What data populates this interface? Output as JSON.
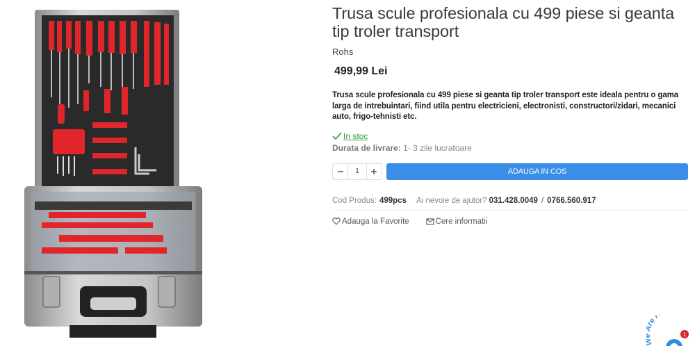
{
  "product": {
    "title": "Trusa scule profesionala cu 499 piese si geanta tip troler transport",
    "brand": "Rohs",
    "price": "499,99 Lei",
    "description": "Trusa scule profesionala cu 499 piese si geanta tip troler transport este ideala pentru o gama larga de intrebuintari, fiind utila pentru electricieni, electronisti, constructori/zidari, mecanici auto, frigo-tehnisti etc.",
    "stock": "In stoc",
    "delivery_label": "Durata de livrare:",
    "delivery_value": "1- 3 zile lucratoare",
    "quantity": "1",
    "add_to_cart": "ADAUGA IN COS",
    "code_label": "Cod Produs:",
    "code_value": "499pcs",
    "help_label": "Ai nevoie de ajutor?",
    "phone1": "031.428.0049",
    "phone_sep": "/",
    "phone2": "0766.560.917",
    "favorite": "Adauga la Favorite",
    "info_request": "Cere informatii"
  },
  "chat": {
    "label": "We Are Here",
    "badge": "1"
  },
  "colors": {
    "accent": "#3b8ee8",
    "stock": "#2a9d3a",
    "tool_red": "#e0262b"
  },
  "icons": [
    "minus-icon",
    "plus-icon",
    "check-icon",
    "heart-icon",
    "envelope-icon",
    "chat-icon"
  ]
}
